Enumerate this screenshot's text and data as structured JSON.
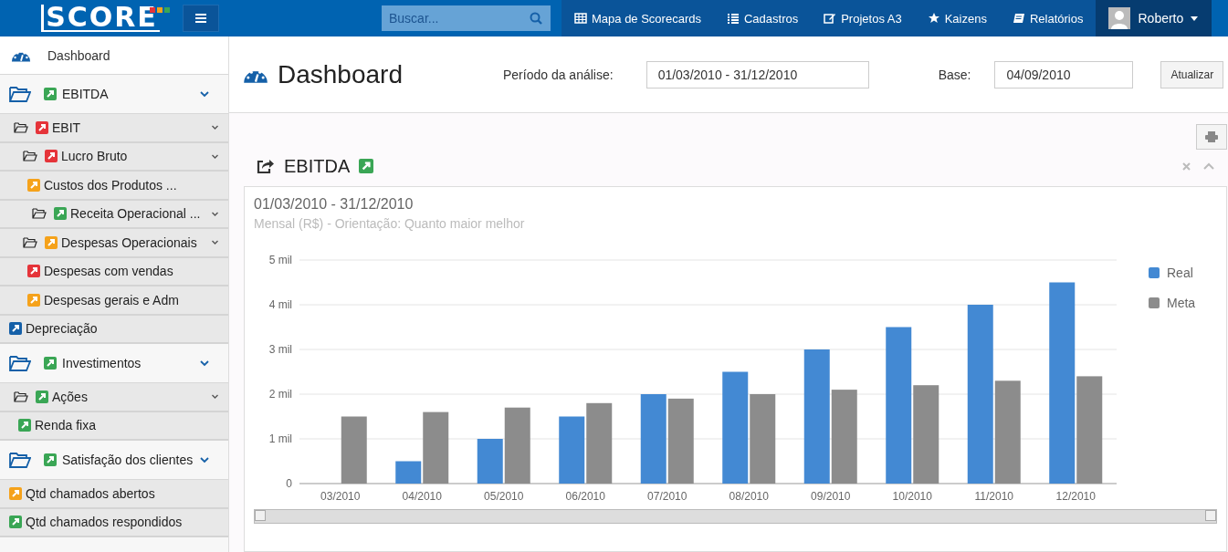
{
  "header": {
    "logo": "SCORE",
    "search": {
      "placeholder": "Buscar..."
    },
    "nav": [
      {
        "label": "Mapa de Scorecards",
        "kind": "table"
      },
      {
        "label": "Cadastros",
        "kind": "list"
      },
      {
        "label": "Projetos A3",
        "kind": "edit"
      },
      {
        "label": "Kaizens",
        "kind": "star"
      },
      {
        "label": "Relatórios",
        "kind": "book"
      }
    ],
    "user": "Roberto"
  },
  "sidebar": {
    "dashboard": "Dashboard",
    "tree": [
      {
        "label": "EBITDA",
        "color": "#3aa655",
        "expanded": true,
        "children": [
          {
            "label": "EBIT",
            "color": "#e5343a",
            "expanded": true,
            "children": [
              {
                "label": "Lucro Bruto",
                "color": "#e5343a",
                "expanded": true,
                "children": [
                  {
                    "label": "Custos dos Produtos ...",
                    "color": "#f5a21b"
                  },
                  {
                    "label": "Receita Operacional ...",
                    "color": "#3aa655",
                    "expanded": true
                  }
                ]
              },
              {
                "label": "Despesas Operacionais",
                "color": "#f5a21b",
                "expanded": true,
                "children": [
                  {
                    "label": "Despesas com vendas",
                    "color": "#e5343a"
                  },
                  {
                    "label": "Despesas gerais e Adm",
                    "color": "#f5a21b"
                  }
                ]
              }
            ]
          },
          {
            "label": "Depreciação",
            "color": "#1560a8"
          }
        ]
      },
      {
        "label": "Investimentos",
        "color": "#3aa655",
        "expanded": true,
        "children": [
          {
            "label": "Ações",
            "color": "#3aa655",
            "expanded": true,
            "children": [
              {
                "label": "Renda fixa",
                "color": "#3aa655"
              }
            ]
          }
        ]
      },
      {
        "label": "Satisfação dos clientes",
        "color": "#3aa655",
        "expanded": true,
        "children": [
          {
            "label": "Qtd chamados abertos",
            "color": "#f5a21b"
          },
          {
            "label": "Qtd chamados respondidos",
            "color": "#3aa655"
          }
        ]
      }
    ]
  },
  "page": {
    "title": "Dashboard",
    "period_label": "Período da análise:",
    "period_value": "01/03/2010 - 31/12/2010",
    "base_label": "Base:",
    "base_value": "04/09/2010",
    "refresh_button": "Atualizar"
  },
  "panel": {
    "title": "EBITDA",
    "status_icon": {
      "color": "#3aa655"
    },
    "period": "01/03/2010 - 31/12/2010",
    "subtitle": "Mensal (R$) - Orientação: Quanto maior melhor",
    "chart_data": {
      "type": "bar",
      "categories": [
        "03/2010",
        "04/2010",
        "05/2010",
        "06/2010",
        "07/2010",
        "08/2010",
        "09/2010",
        "10/2010",
        "11/2010",
        "12/2010"
      ],
      "series": [
        {
          "name": "Real",
          "color": "#4389d3",
          "values": [
            null,
            0.5,
            1,
            1.5,
            2,
            2.5,
            3,
            3.5,
            4,
            4.5
          ]
        },
        {
          "name": "Meta",
          "color": "#8c8c8c",
          "values": [
            1.5,
            1.6,
            1.7,
            1.8,
            1.9,
            2,
            2.1,
            2.2,
            2.3,
            2.4
          ]
        }
      ],
      "ylim": [
        0,
        5
      ],
      "grid": true,
      "legend": "right",
      "yticks": [
        {
          "value": 0,
          "label": "0"
        },
        {
          "value": 1,
          "label": "1 mil"
        },
        {
          "value": 2,
          "label": "2 mil"
        },
        {
          "value": 3,
          "label": "3 mil"
        },
        {
          "value": 4,
          "label": "4 mil"
        },
        {
          "value": 5,
          "label": "5 mil"
        }
      ]
    }
  }
}
